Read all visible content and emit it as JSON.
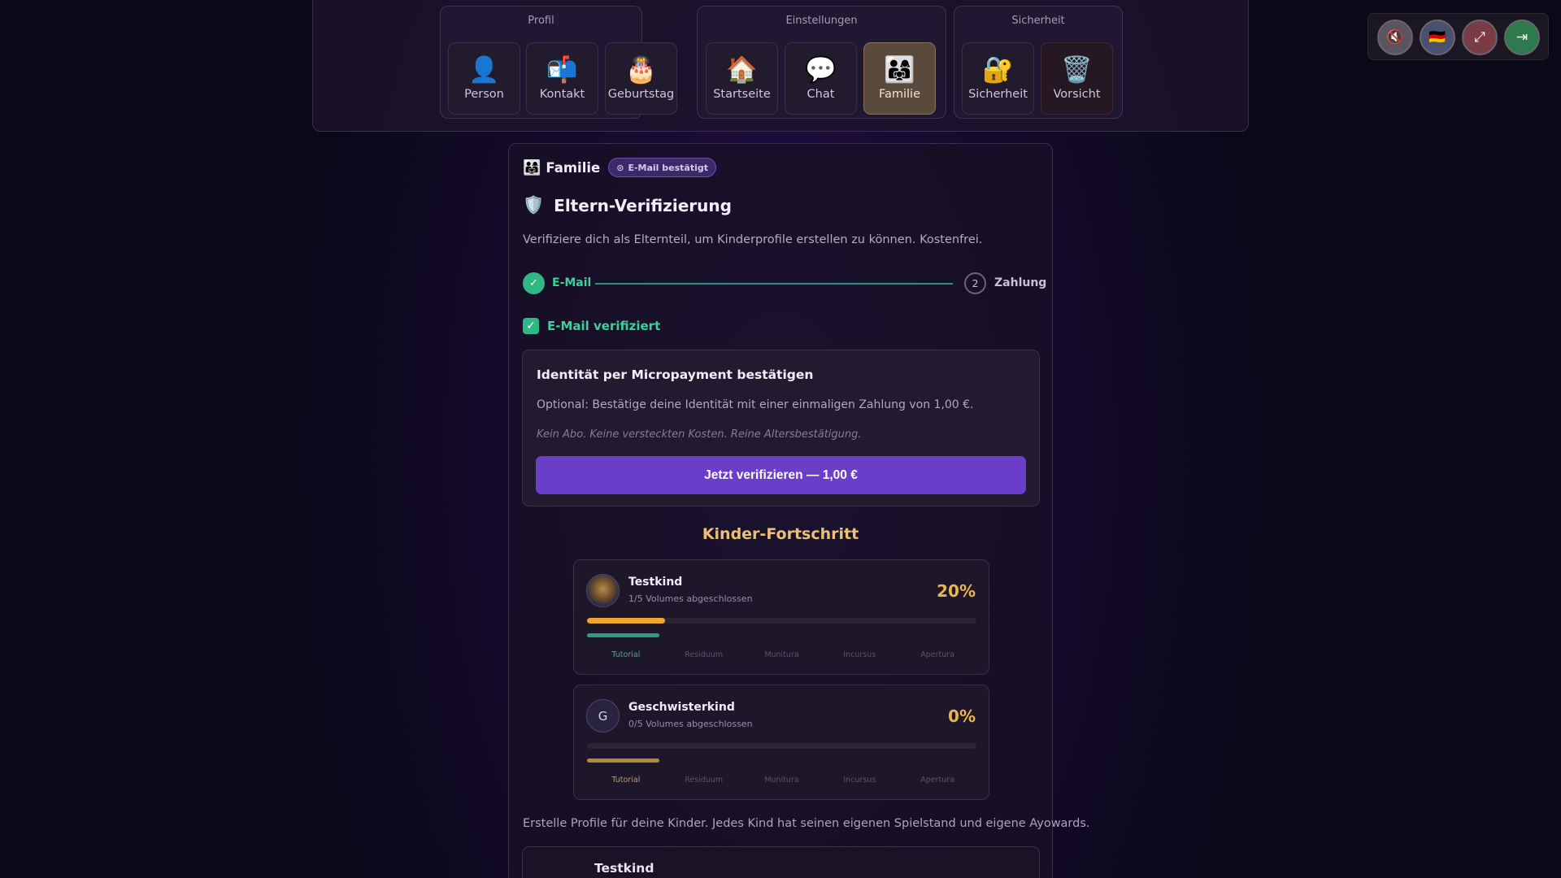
{
  "nav": {
    "groups": [
      {
        "title": "Profil",
        "items": [
          {
            "icon": "👤",
            "label": "Person"
          },
          {
            "icon": "📬",
            "label": "Kontakt"
          },
          {
            "icon": "🎂",
            "label": "Geburtstag"
          }
        ]
      },
      {
        "title": "Einstellungen",
        "items": [
          {
            "icon": "🏠",
            "label": "Startseite"
          },
          {
            "icon": "💬",
            "label": "Chat"
          },
          {
            "icon": "👨‍👩‍👧",
            "label": "Familie"
          }
        ]
      },
      {
        "title": "Sicherheit",
        "items": [
          {
            "icon": "🔐",
            "label": "Sicherheit"
          },
          {
            "icon": "🗑️",
            "label": "Vorsicht"
          }
        ]
      }
    ],
    "active": "Familie"
  },
  "controls": {
    "mute_icon": "🔇",
    "language_icon": "🇩🇪",
    "fullscreen_icon": "⤢",
    "logout_icon": "⇥"
  },
  "family": {
    "icon": "👨‍👩‍👧",
    "title": "Familie",
    "badge": "E-Mail bestätigt",
    "badge_icon": "⊙"
  },
  "verification": {
    "icon": "🛡️",
    "title": "Eltern-Verifizierung",
    "description": "Verifiziere dich als Elternteil, um Kinderprofile erstellen zu können. Kostenfrei.",
    "steps": [
      {
        "marker": "✓",
        "label": "E-Mail",
        "state": "done"
      },
      {
        "marker": "2",
        "label": "Zahlung",
        "state": "pending"
      }
    ],
    "verified_icon": "✓",
    "verified_text": "E-Mail verifiziert"
  },
  "payment": {
    "title": "Identität per Micropayment bestätigen",
    "description": "Optional: Bestätige deine Identität mit einer einmaligen Zahlung von 1,00 €.",
    "note": "Kein Abo. Keine versteckten Kosten. Reine Altersbestätigung.",
    "button": "Jetzt verifizieren — 1,00 €"
  },
  "kids_progress": {
    "title": "Kinder-Fortschritt",
    "volume_labels": [
      "Tutorial",
      "Residuum",
      "Munitura",
      "Incursus",
      "Apertura"
    ],
    "kids": [
      {
        "name": "Testkind",
        "subtitle": "1/5 Volumes abgeschlossen",
        "percent_text": "20%",
        "progress": 0.2,
        "avatar": "",
        "mini_color": "#2f9c7e",
        "current_color": "#3cb38d"
      },
      {
        "name": "Geschwisterkind",
        "subtitle": "0/5 Volumes abgeschlossen",
        "percent_text": "0%",
        "progress": 0.0,
        "avatar": "G",
        "mini_color": "#b08a3c",
        "current_color": "#c79a45"
      }
    ]
  },
  "create_text": "Erstelle Profile für deine Kinder. Jedes Kind hat seinen eigenen Spielstand und eigene Ayowards.",
  "kid_list": [
    {
      "name": "Testkind"
    }
  ],
  "colors": {
    "accent_purple": "#6b3ec9",
    "success_green": "#2fb886",
    "gold": "#e8b64a",
    "progress_orange": "#f0a531"
  }
}
